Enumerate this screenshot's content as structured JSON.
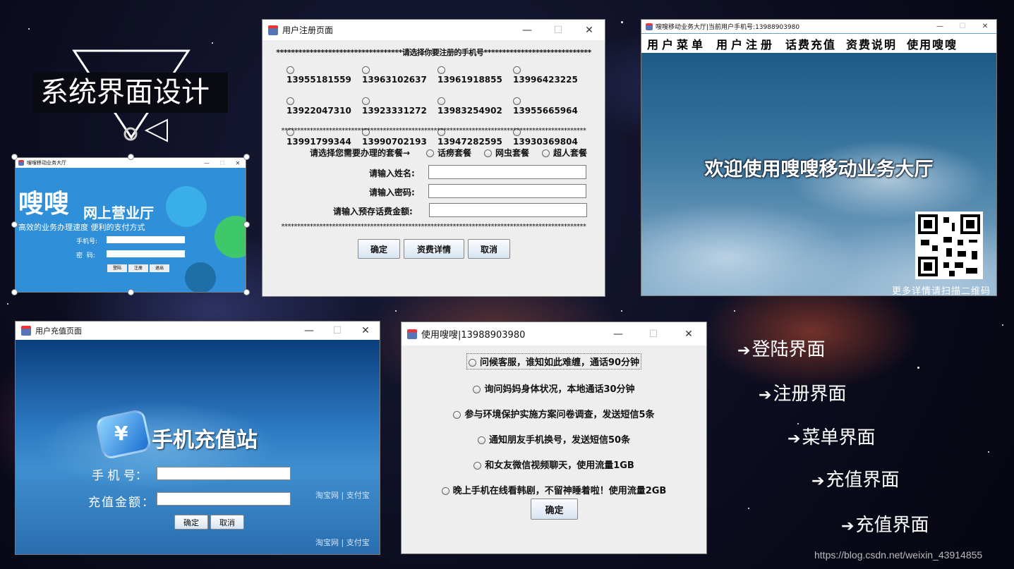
{
  "slide_title": "系统界面设计",
  "login_window": {
    "title": "嗖嗖移动业务大厅",
    "brand": "嗖嗖",
    "brand_sub": "网上营业厅",
    "slogan": "高效的业务办理速度 便利的支付方式",
    "phone_label": "手机号:",
    "password_label": "密  码:",
    "buttons": [
      "登陆",
      "注册",
      "退出"
    ]
  },
  "register_window": {
    "title": "用户注册页面",
    "header_line": "**********************************请选择你要注册的手机号*****************************",
    "numbers": [
      "13955181559",
      "13963102637",
      "13961918855",
      "13996423225",
      "13922047310",
      "13923331272",
      "13983254902",
      "13955665964",
      "13991799344",
      "13990702193",
      "13947282595",
      "13930369804"
    ],
    "separator": "************************************************************************************************",
    "plan_label": "请选择您需要办理的套餐→",
    "plans": [
      "话痨套餐",
      "网虫套餐",
      "超人套餐"
    ],
    "name_label": "请输入姓名:",
    "password_label": "请输入密码:",
    "deposit_label": "请输入预存话费金额:",
    "buttons": [
      "确定",
      "资费详情",
      "取消"
    ]
  },
  "menu_window": {
    "title": "嗖嗖移动业务大厅|当前用户手机号:13988903980",
    "menu": [
      "用户菜单",
      "用户注册",
      "话费充值",
      "资费说明",
      "使用嗖嗖"
    ],
    "welcome": "欢迎使用嗖嗖移动业务大厅",
    "qr_caption": "更多详情请扫描二维码"
  },
  "recharge_window": {
    "title": "用户充值页面",
    "brand": "手机充值站",
    "phone_label": "手 机 号：",
    "amount_label": "充值金额：",
    "partners": "淘宝网 | 支付宝",
    "buttons": [
      "确定",
      "取消"
    ]
  },
  "use_window": {
    "title": "使用嗖嗖|13988903980",
    "options": [
      "问候客服，谁知如此难缠，通话90分钟",
      "询问妈妈身体状况，本地通话30分钟",
      "参与环境保护实施方案问卷调查，发送短信5条",
      "通知朋友手机换号，发送短信50条",
      "和女友微信视频聊天，使用流量1GB",
      "晚上手机在线看韩剧，不留神睡着啦！使用流量2GB"
    ],
    "confirm": "确定"
  },
  "legend_items": [
    "登陆界面",
    "注册界面",
    "菜单界面",
    "充值界面",
    "充值界面"
  ],
  "watermark": "https://blog.csdn.net/weixin_43914855"
}
